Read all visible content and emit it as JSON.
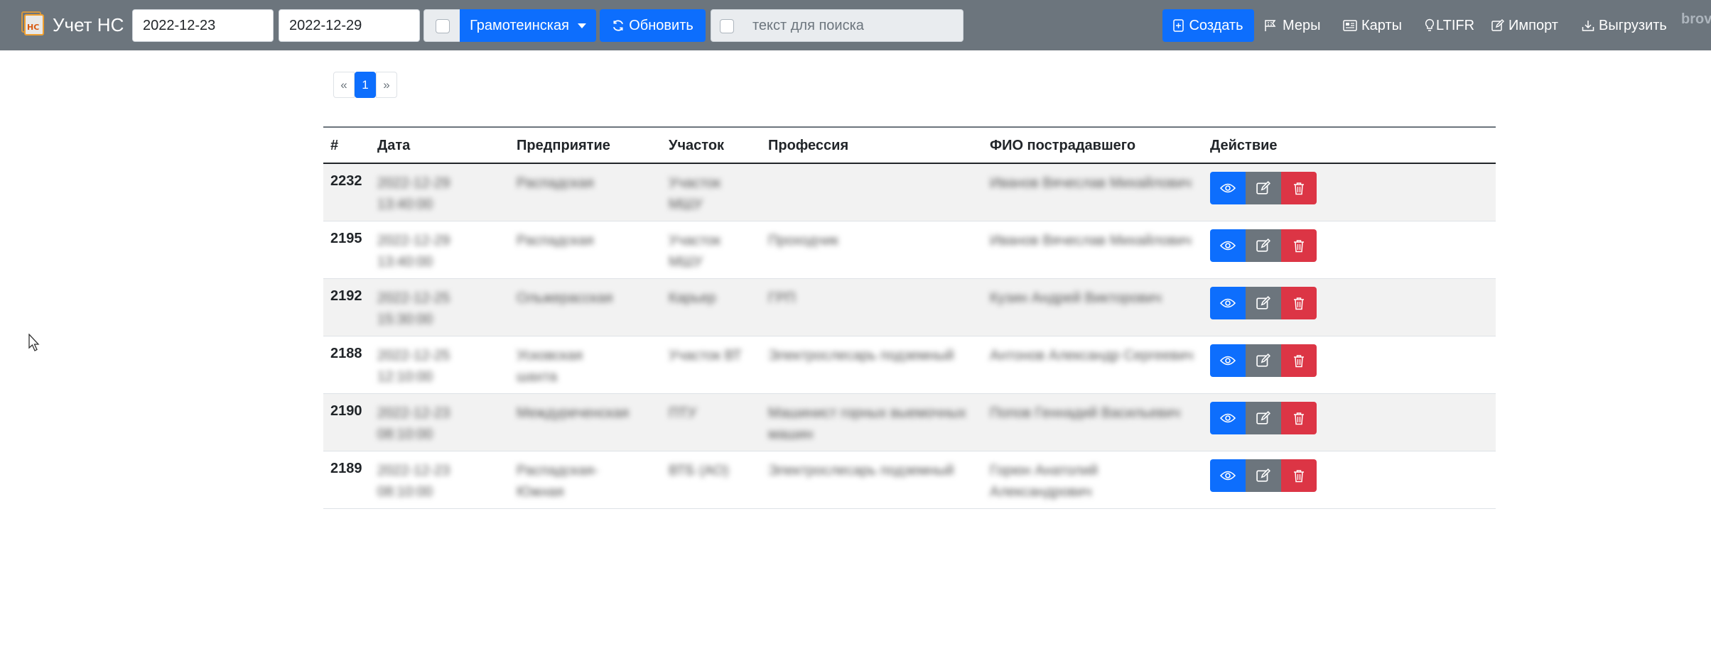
{
  "app": {
    "brand_icon_text": "НС",
    "brand_name": "Учет НС"
  },
  "filters": {
    "date_from": "2022-12-23",
    "date_to": "2022-12-29",
    "site_dropdown": "Грамотеинская",
    "refresh_label": "Обновить",
    "search_placeholder": "текст для поиска"
  },
  "nav": {
    "create": "Создать",
    "measures": "Меры",
    "cards": "Карты",
    "ltifr": "LTIFR",
    "import": "Импорт",
    "export": "Выгрузить",
    "cutoff": "brov"
  },
  "pagination": {
    "prev": "«",
    "page": "1",
    "next": "»"
  },
  "table": {
    "headers": {
      "id": "#",
      "date": "Дата",
      "enterprise": "Предприятие",
      "section": "Участок",
      "profession": "Профессия",
      "victim": "ФИО пострадавшего",
      "action": "Действие"
    },
    "rows": [
      {
        "id": "2232",
        "date": "2022-12-29 13:40:00",
        "enterprise": "Распадская",
        "section": "Участок МШУ",
        "profession": "",
        "victim": "Иванов Вячеслав Михайлович"
      },
      {
        "id": "2195",
        "date": "2022-12-29 13:40:00",
        "enterprise": "Распадская",
        "section": "Участок МШУ",
        "profession": "Проходчик",
        "victim": "Иванов Вячеслав Михайлович"
      },
      {
        "id": "2192",
        "date": "2022-12-25 15:30:00",
        "enterprise": "Ольжерасская",
        "section": "Карьер",
        "profession": "ГРП",
        "victim": "Кузин Андрей Викторович"
      },
      {
        "id": "2188",
        "date": "2022-12-25 12:10:00",
        "enterprise": "Усковская шахта",
        "section": "Участок ВТ",
        "profession": "Электрослесарь подземный",
        "victim": "Антонов Александр Сергеевич"
      },
      {
        "id": "2190",
        "date": "2022-12-23 08:10:00",
        "enterprise": "Междуреченская",
        "section": "ПТУ",
        "profession": "Машинист горных выемочных машин",
        "victim": "Попов Геннадий Васильевич"
      },
      {
        "id": "2189",
        "date": "2022-12-23 08:10:00",
        "enterprise": "Распадская-Южная",
        "section": "ВТБ (АО)",
        "profession": "Электрослесарь подземный",
        "victim": "Горюн Анатолий Александрович"
      }
    ]
  },
  "icons": {
    "refresh": "refresh-icon",
    "create": "plus-square-icon",
    "measures": "flags-icon",
    "cards": "newspaper-icon",
    "ltifr": "lightbulb-icon",
    "import": "pencil-square-icon",
    "export": "download-icon",
    "view": "eye-icon",
    "edit": "edit-icon",
    "delete": "trash-icon"
  },
  "colors": {
    "navbar": "#6c757d",
    "primary": "#0d6efd",
    "secondary": "#6c757d",
    "danger": "#dc3545"
  }
}
